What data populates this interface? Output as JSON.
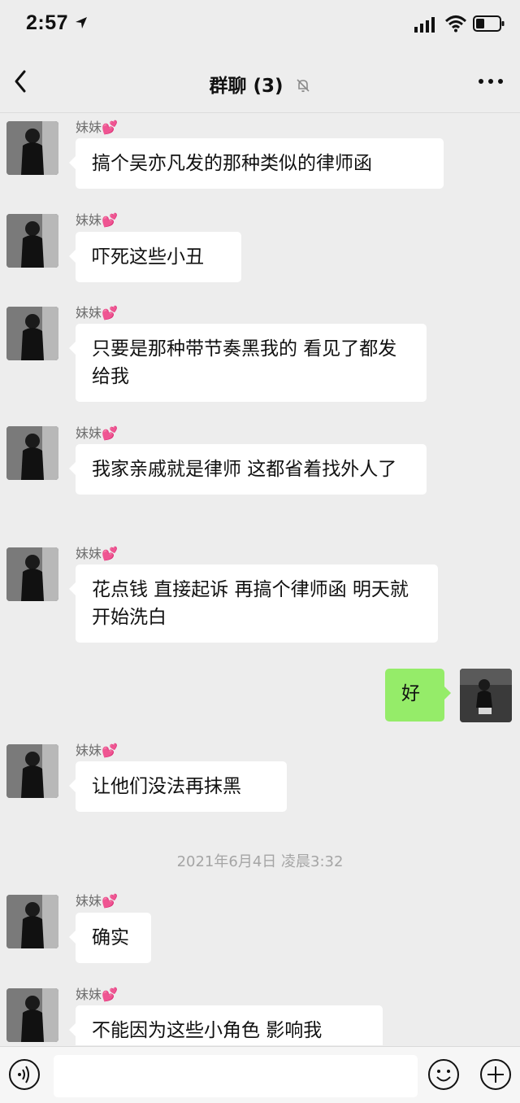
{
  "status_bar": {
    "time": "2:57"
  },
  "header": {
    "title": "群聊 (3)"
  },
  "sender": {
    "name": "妹妹",
    "emoji": "💕"
  },
  "messages": [
    {
      "from": "other",
      "text": "搞个吴亦凡发的那种类似的律师函"
    },
    {
      "from": "other",
      "text": "吓死这些小丑"
    },
    {
      "from": "other",
      "text": "只要是那种带节奏黑我的 看见了都发给我"
    },
    {
      "from": "other",
      "text": "我家亲戚就是律师 这都省着找外人了"
    },
    {
      "from": "other",
      "text": "花点钱 直接起诉 再搞个律师函 明天就开始洗白"
    },
    {
      "from": "me",
      "text": "好"
    },
    {
      "from": "other",
      "text": "让他们没法再抹黑"
    },
    {
      "from": "other",
      "text": "确实"
    },
    {
      "from": "other",
      "text": "不能因为这些小角色 影响我"
    }
  ],
  "timestamp": "2021年6月4日 凌晨3:32",
  "input": {
    "placeholder": ""
  },
  "icons": {
    "back": "back-chevron-icon",
    "mute": "mute-bell-icon",
    "more": "more-dots-icon",
    "voice": "voice-icon",
    "emoji": "emoji-icon",
    "plus": "plus-icon"
  },
  "colors": {
    "background": "#ededed",
    "bubble_other": "#ffffff",
    "bubble_me": "#95ec69",
    "heart": "#e8509a"
  }
}
